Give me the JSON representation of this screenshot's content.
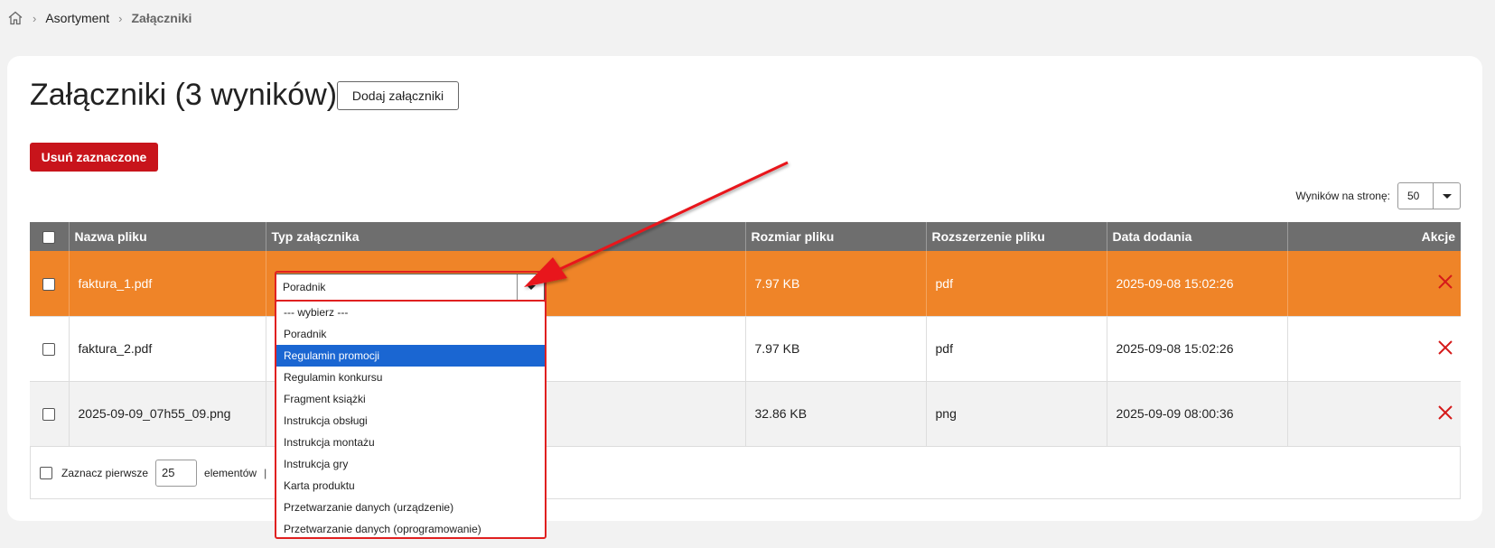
{
  "breadcrumb": {
    "items": [
      "Asortyment",
      "Załączniki"
    ]
  },
  "page": {
    "title": "Załączniki (3 wyników)",
    "add_label": "Dodaj załączniki",
    "delete_label": "Usuń zaznaczone",
    "per_page_label": "Wyników na stronę:",
    "per_page_value": "50"
  },
  "table": {
    "columns": [
      "Nazwa pliku",
      "Typ załącznika",
      "Rozmiar pliku",
      "Rozszerzenie pliku",
      "Data dodania",
      "Akcje"
    ],
    "rows": [
      {
        "name": "faktura_1.pdf",
        "type": "Poradnik",
        "size": "7.97 KB",
        "ext": "pdf",
        "date": "2025-09-08 15:02:26"
      },
      {
        "name": "faktura_2.pdf",
        "type": "",
        "size": "7.97 KB",
        "ext": "pdf",
        "date": "2025-09-08 15:02:26"
      },
      {
        "name": "2025-09-09_07h55_09.png",
        "type": "",
        "size": "32.86 KB",
        "ext": "png",
        "date": "2025-09-09 08:00:36"
      }
    ]
  },
  "footer": {
    "select_first_label": "Zaznacz pierwsze",
    "count": "25",
    "elements_label": "elementów",
    "separator": "|"
  },
  "dropdown": {
    "selected": "Poradnik",
    "highlighted": "Regulamin promocji",
    "options": [
      "--- wybierz ---",
      "Poradnik",
      "Regulamin promocji",
      "Regulamin konkursu",
      "Fragment książki",
      "Instrukcja obsługi",
      "Instrukcja montażu",
      "Instrukcja gry",
      "Karta produktu",
      "Przetwarzanie danych (urządzenie)",
      "Przetwarzanie danych (oprogramowanie)"
    ]
  },
  "colors": {
    "accent_row": "#ef8428",
    "danger": "#c8141b",
    "highlight": "#1a66d2",
    "annotation": "#e02020"
  }
}
